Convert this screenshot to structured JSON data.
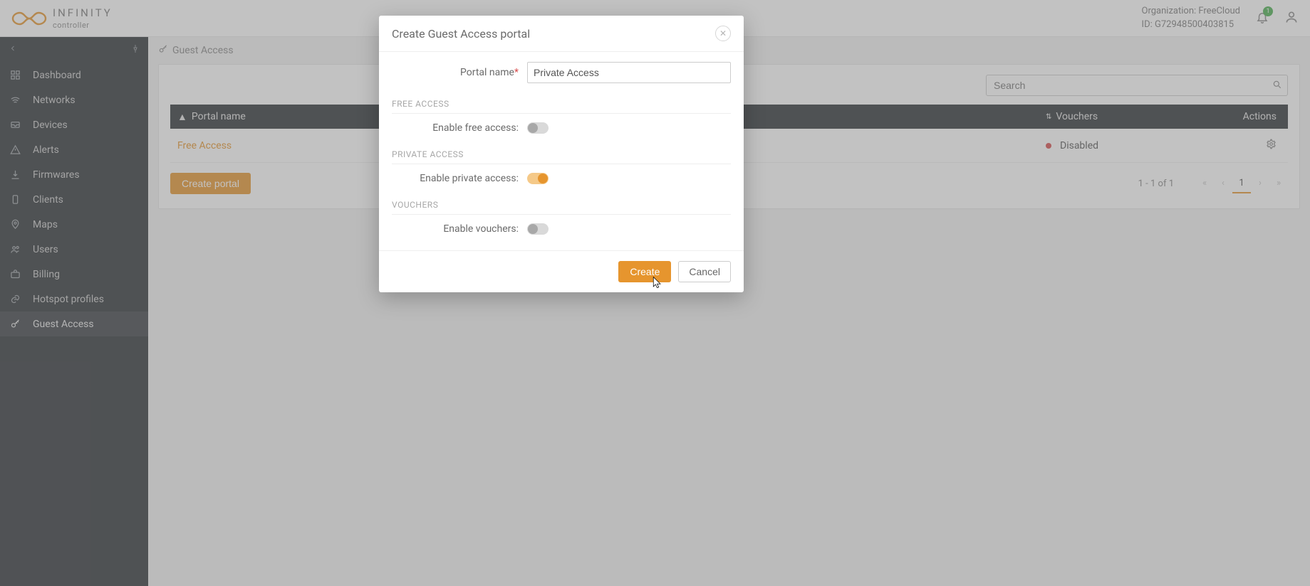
{
  "brand": {
    "title": "INFINITY",
    "subtitle": "controller"
  },
  "header": {
    "org_label": "Organization: FreeCloud",
    "id_label": "ID: G72948500403815",
    "bell_badge": "1"
  },
  "sidebar": {
    "items": [
      {
        "label": "Dashboard"
      },
      {
        "label": "Networks"
      },
      {
        "label": "Devices"
      },
      {
        "label": "Alerts"
      },
      {
        "label": "Firmwares"
      },
      {
        "label": "Clients"
      },
      {
        "label": "Maps"
      },
      {
        "label": "Users"
      },
      {
        "label": "Billing"
      },
      {
        "label": "Hotspot profiles"
      },
      {
        "label": "Guest Access"
      }
    ]
  },
  "breadcrumb": {
    "title": "Guest Access"
  },
  "search": {
    "placeholder": "Search"
  },
  "grid": {
    "col_name": "Portal name",
    "col_vouchers": "Vouchers",
    "col_actions": "Actions",
    "rows": [
      {
        "name": "Free Access",
        "voucher_status": "Disabled"
      }
    ],
    "create_btn": "Create portal",
    "range": "1 - 1 of 1",
    "pager": {
      "first": "«",
      "prev": "‹",
      "page": "1",
      "next": "›",
      "last": "»"
    }
  },
  "modal": {
    "title": "Create Guest Access portal",
    "portal_name_label": "Portal name",
    "portal_name_value": "Private Access",
    "section_free": "FREE ACCESS",
    "free_toggle_label": "Enable free access:",
    "section_private": "PRIVATE ACCESS",
    "private_toggle_label": "Enable private access:",
    "section_vouchers": "VOUCHERS",
    "vouchers_toggle_label": "Enable vouchers:",
    "create_btn": "Create",
    "cancel_btn": "Cancel"
  }
}
